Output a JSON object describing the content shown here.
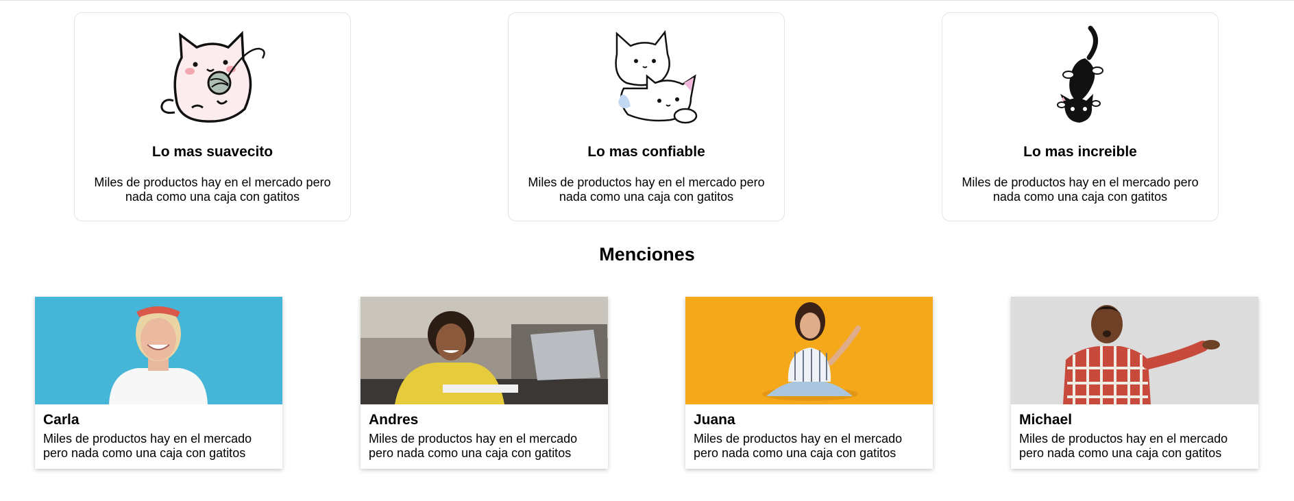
{
  "features": [
    {
      "title": "Lo mas suavecito",
      "description": "Miles de productos hay en el mercado pero nada como una caja con gatitos",
      "icon": "cat-with-yarn-icon"
    },
    {
      "title": "Lo mas confiable",
      "description": "Miles de productos hay en el mercado pero nada como una caja con gatitos",
      "icon": "two-kittens-icon"
    },
    {
      "title": "Lo mas increible",
      "description": "Miles de productos hay en el mercado pero nada como una caja con gatitos",
      "icon": "black-cat-icon"
    }
  ],
  "mentions": {
    "heading": "Menciones",
    "people": [
      {
        "name": "Carla",
        "description": "Miles de productos hay en el mercado pero nada como una caja con gatitos",
        "photo_bg": "#45b5d8"
      },
      {
        "name": "Andres",
        "description": "Miles de productos hay en el mercado pero nada como una caja con gatitos",
        "photo_bg": "#8a8176"
      },
      {
        "name": "Juana",
        "description": "Miles de productos hay en el mercado pero nada como una caja con gatitos",
        "photo_bg": "#f5a91a"
      },
      {
        "name": "Michael",
        "description": "Miles de productos hay en el mercado pero nada como una caja con gatitos",
        "photo_bg": "#dcdcdc"
      }
    ]
  }
}
